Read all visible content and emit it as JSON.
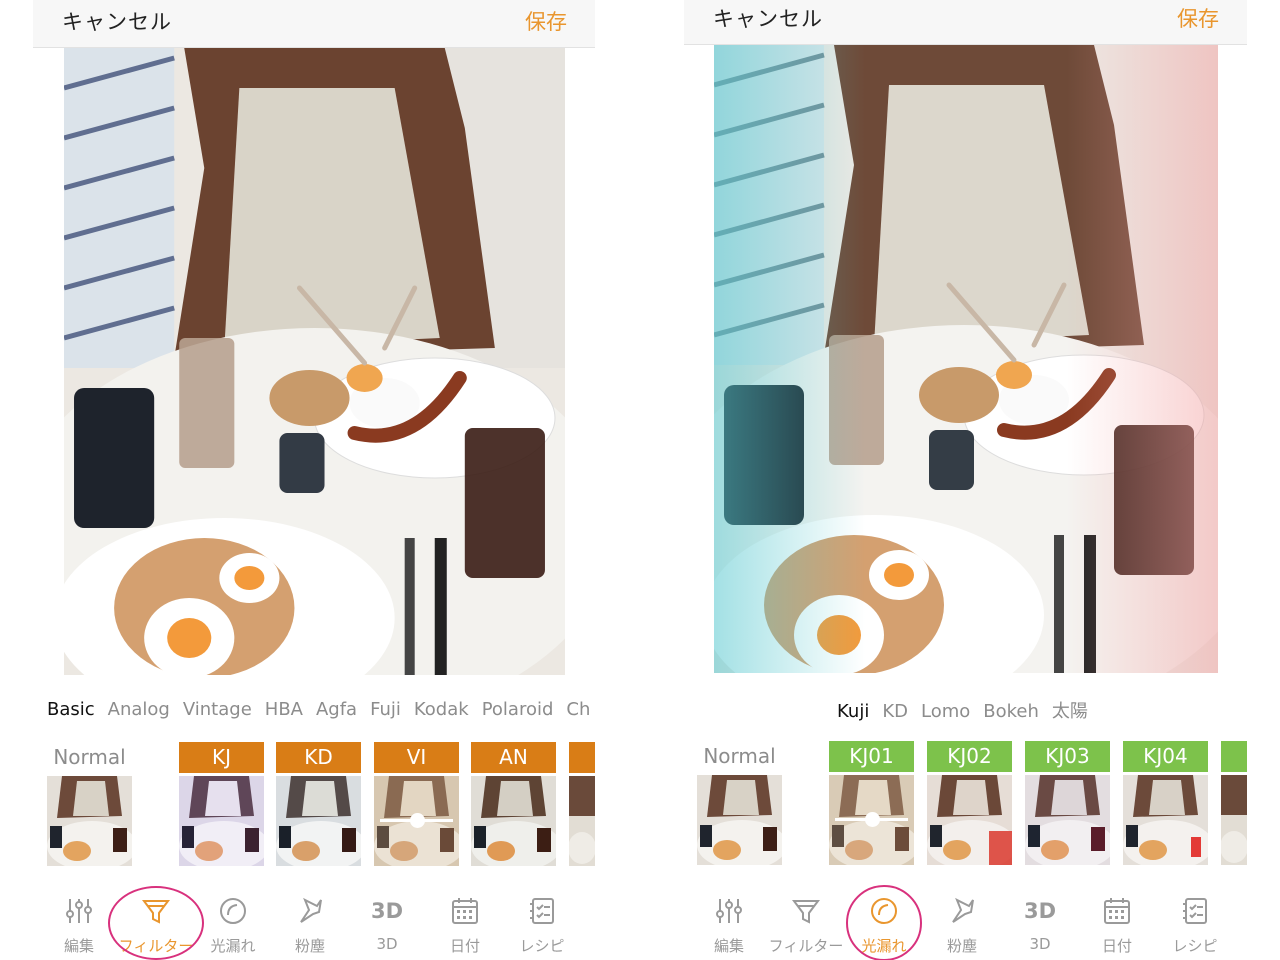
{
  "left": {
    "header": {
      "cancel": "キャンセル",
      "save": "保存"
    },
    "categories": [
      "Basic",
      "Analog",
      "Vintage",
      "HBA",
      "Agfa",
      "Fuji",
      "Kodak",
      "Polaroid",
      "Ch"
    ],
    "active_category": "Basic",
    "filters": [
      {
        "label": "Normal",
        "header_color": ""
      },
      {
        "label": "KJ",
        "header_color": "#d97d16"
      },
      {
        "label": "KD",
        "header_color": "#d97d16"
      },
      {
        "label": "VI",
        "header_color": "#d97d16",
        "selected": true
      },
      {
        "label": "AN",
        "header_color": "#d97d16"
      }
    ],
    "toolbar": [
      {
        "label": "編集",
        "icon": "sliders-icon"
      },
      {
        "label": "フィルター",
        "icon": "filter-funnel-icon",
        "active": true
      },
      {
        "label": "光漏れ",
        "icon": "light-leak-icon"
      },
      {
        "label": "粉塵",
        "icon": "dust-icon"
      },
      {
        "label": "3D",
        "icon": "3d-icon",
        "icon_text": "3D"
      },
      {
        "label": "日付",
        "icon": "calendar-icon"
      },
      {
        "label": "レシピ",
        "icon": "recipe-icon"
      }
    ]
  },
  "right": {
    "header": {
      "cancel": "キャンセル",
      "save": "保存"
    },
    "categories": [
      "Kuji",
      "KD",
      "Lomo",
      "Bokeh",
      "太陽"
    ],
    "active_category": "Kuji",
    "filters": [
      {
        "label": "Normal",
        "header_color": ""
      },
      {
        "label": "KJ01",
        "header_color": "#7dc24b",
        "selected": true
      },
      {
        "label": "KJ02",
        "header_color": "#7dc24b"
      },
      {
        "label": "KJ03",
        "header_color": "#7dc24b"
      },
      {
        "label": "KJ04",
        "header_color": "#7dc24b"
      }
    ],
    "toolbar": [
      {
        "label": "編集",
        "icon": "sliders-icon"
      },
      {
        "label": "フィルター",
        "icon": "filter-funnel-icon"
      },
      {
        "label": "光漏れ",
        "icon": "light-leak-icon",
        "active": true
      },
      {
        "label": "粉塵",
        "icon": "dust-icon"
      },
      {
        "label": "3D",
        "icon": "3d-icon",
        "icon_text": "3D"
      },
      {
        "label": "日付",
        "icon": "calendar-icon"
      },
      {
        "label": "レシピ",
        "icon": "recipe-icon"
      }
    ]
  },
  "colors": {
    "accent": "#e9962e",
    "highlight_ring": "#d8317d"
  }
}
